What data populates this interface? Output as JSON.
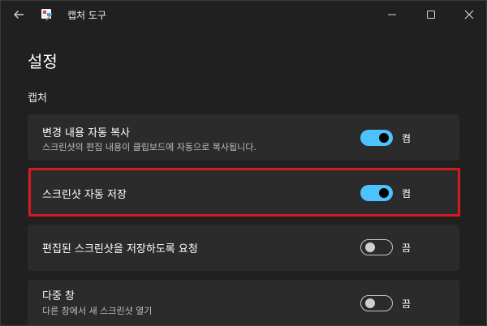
{
  "window": {
    "title": "캡처 도구"
  },
  "page": {
    "title": "설정",
    "section_title": "캡처"
  },
  "settings": [
    {
      "label": "변경 내용 자동 복사",
      "description": "스크린샷의 편집 내용이 클립보드에 자동으로 복사됩니다.",
      "state_label": "켬",
      "on": true
    },
    {
      "label": "스크린샷 자동 저장",
      "description": "",
      "state_label": "켬",
      "on": true
    },
    {
      "label": "편집된 스크린샷을 저장하도록 요청",
      "description": "",
      "state_label": "끔",
      "on": false
    },
    {
      "label": "다중 창",
      "description": "다른 창에서 새 스크린샷 열기",
      "state_label": "끔",
      "on": false
    }
  ],
  "colors": {
    "accent": "#4cc2ff",
    "highlight": "#d71920",
    "background": "#202020",
    "card": "#2b2b2b"
  }
}
